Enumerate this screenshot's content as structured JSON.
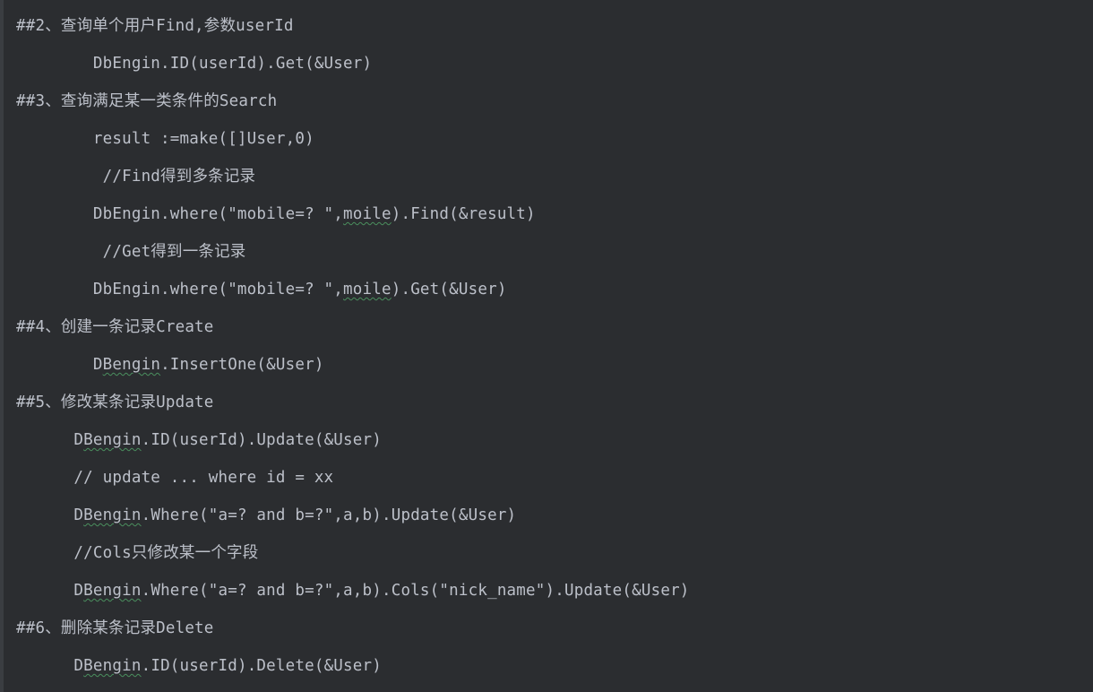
{
  "code": {
    "lines": [
      {
        "indent": "",
        "segments": [
          {
            "t": "##2、查询单个用户Find,参数userId"
          }
        ]
      },
      {
        "indent": "        ",
        "segments": [
          {
            "t": "DbEngin.ID(userId).Get(&User)"
          }
        ]
      },
      {
        "indent": "",
        "segments": [
          {
            "t": "##3、查询满足某一类条件的Search"
          }
        ]
      },
      {
        "indent": "        ",
        "segments": [
          {
            "t": "result :=make([]User,0)"
          }
        ]
      },
      {
        "indent": "         ",
        "segments": [
          {
            "t": "//Find得到多条记录"
          }
        ]
      },
      {
        "indent": "        ",
        "segments": [
          {
            "t": "DbEngin.where(\"mobile=? \","
          },
          {
            "t": "moile",
            "w": true
          },
          {
            "t": ").Find(&result)"
          }
        ]
      },
      {
        "indent": "         ",
        "segments": [
          {
            "t": "//Get得到一条记录"
          }
        ]
      },
      {
        "indent": "        ",
        "segments": [
          {
            "t": "DbEngin.where(\"mobile=? \","
          },
          {
            "t": "moile",
            "w": true
          },
          {
            "t": ").Get(&User)"
          }
        ]
      },
      {
        "indent": "",
        "segments": [
          {
            "t": "##4、创建一条记录Create"
          }
        ]
      },
      {
        "indent": "        ",
        "segments": [
          {
            "t": "D"
          },
          {
            "t": "Bengin",
            "w": true
          },
          {
            "t": ".InsertOne(&User)"
          }
        ]
      },
      {
        "indent": "",
        "segments": [
          {
            "t": "##5、修改某条记录Update"
          }
        ]
      },
      {
        "indent": "      ",
        "segments": [
          {
            "t": "D"
          },
          {
            "t": "Bengin",
            "w": true
          },
          {
            "t": ".ID(userId).Update(&User)"
          }
        ]
      },
      {
        "indent": "      ",
        "segments": [
          {
            "t": "// update ... where id = xx"
          }
        ]
      },
      {
        "indent": "      ",
        "segments": [
          {
            "t": "D"
          },
          {
            "t": "Bengin",
            "w": true
          },
          {
            "t": ".Where(\"a=? and b=?\",a,b).Update(&User)"
          }
        ]
      },
      {
        "indent": "      ",
        "segments": [
          {
            "t": "//Cols只修改某一个字段"
          }
        ]
      },
      {
        "indent": "      ",
        "segments": [
          {
            "t": "D"
          },
          {
            "t": "Bengin",
            "w": true
          },
          {
            "t": ".Where(\"a=? and b=?\",a,b).Cols(\"nick_name\").Update(&User)"
          }
        ]
      },
      {
        "indent": "",
        "segments": [
          {
            "t": "##6、删除某条记录Delete"
          }
        ]
      },
      {
        "indent": "      ",
        "segments": [
          {
            "t": "D"
          },
          {
            "t": "Bengin",
            "w": true
          },
          {
            "t": ".ID(userId).Delete(&User)"
          }
        ]
      }
    ]
  }
}
